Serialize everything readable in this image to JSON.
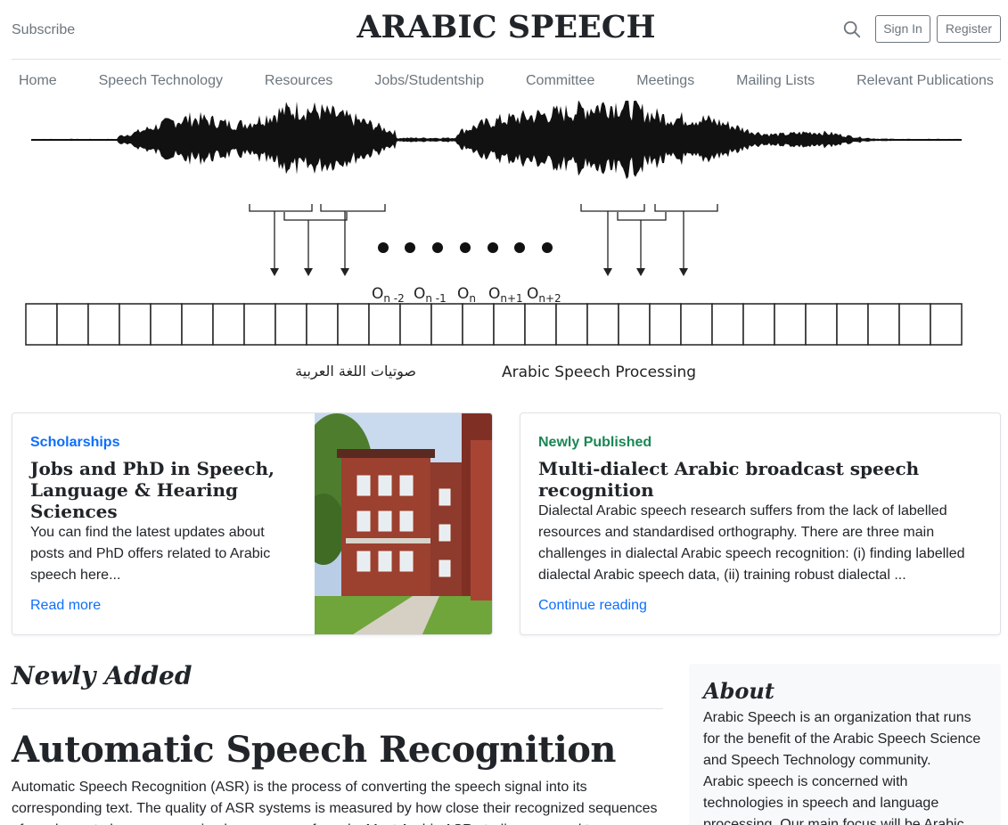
{
  "header": {
    "subscribe": "Subscribe",
    "brand": "ARABIC SPEECH",
    "sign_in": "Sign In",
    "register": "Register"
  },
  "nav": {
    "items": [
      {
        "label": "Home"
      },
      {
        "label": "Speech Technology"
      },
      {
        "label": "Resources"
      },
      {
        "label": "Jobs/Studentship"
      },
      {
        "label": "Committee"
      },
      {
        "label": "Meetings"
      },
      {
        "label": "Mailing Lists"
      },
      {
        "label": "Relevant Publications"
      }
    ]
  },
  "hero": {
    "arabic_caption": "صوتيات اللغة العربية",
    "english_caption": "Arabic Speech Processing",
    "obs_labels": [
      {
        "base": "O",
        "sub": "n -2"
      },
      {
        "base": "O",
        "sub": "n -1"
      },
      {
        "base": "O",
        "sub": "n"
      },
      {
        "base": "O",
        "sub": "n+1"
      },
      {
        "base": "O",
        "sub": "n+2"
      }
    ]
  },
  "cards": {
    "left": {
      "category": "Scholarships",
      "category_color": "#0d6efd",
      "title": "Jobs and PhD in Speech, Language & Hearing Sciences",
      "text": "You can find the latest updates about posts and PhD offers related to Arabic speech here...",
      "link": "Read more"
    },
    "right": {
      "category": "Newly Published",
      "category_color": "#198754",
      "title": "Multi-dialect Arabic broadcast speech recognition",
      "text": "Dialectal Arabic speech research suffers from the lack of labelled resources and standardised orthography. There are three main challenges in dialectal Arabic speech recognition: (i) finding labelled dialectal Arabic speech data, (ii) training robust dialectal ...",
      "link": "Continue reading"
    }
  },
  "newly_added": {
    "heading": "Newly Added",
    "post_title": "Automatic Speech Recognition",
    "post_body": "Automatic Speech Recognition (ASR) is the process of converting the speech signal into its corresponding text. The quality of ASR systems is measured by how close their recognized sequences of words are to human recognized sequences of words. Most Arabic ASR studies are used to"
  },
  "about": {
    "heading": "About",
    "text1": "Arabic Speech is an organization that runs for the benefit of the Arabic Speech Science and Speech Technology community.",
    "text2": "Arabic speech is concerned with technologies in speech and language processing. Our main focus will be Arabic"
  }
}
